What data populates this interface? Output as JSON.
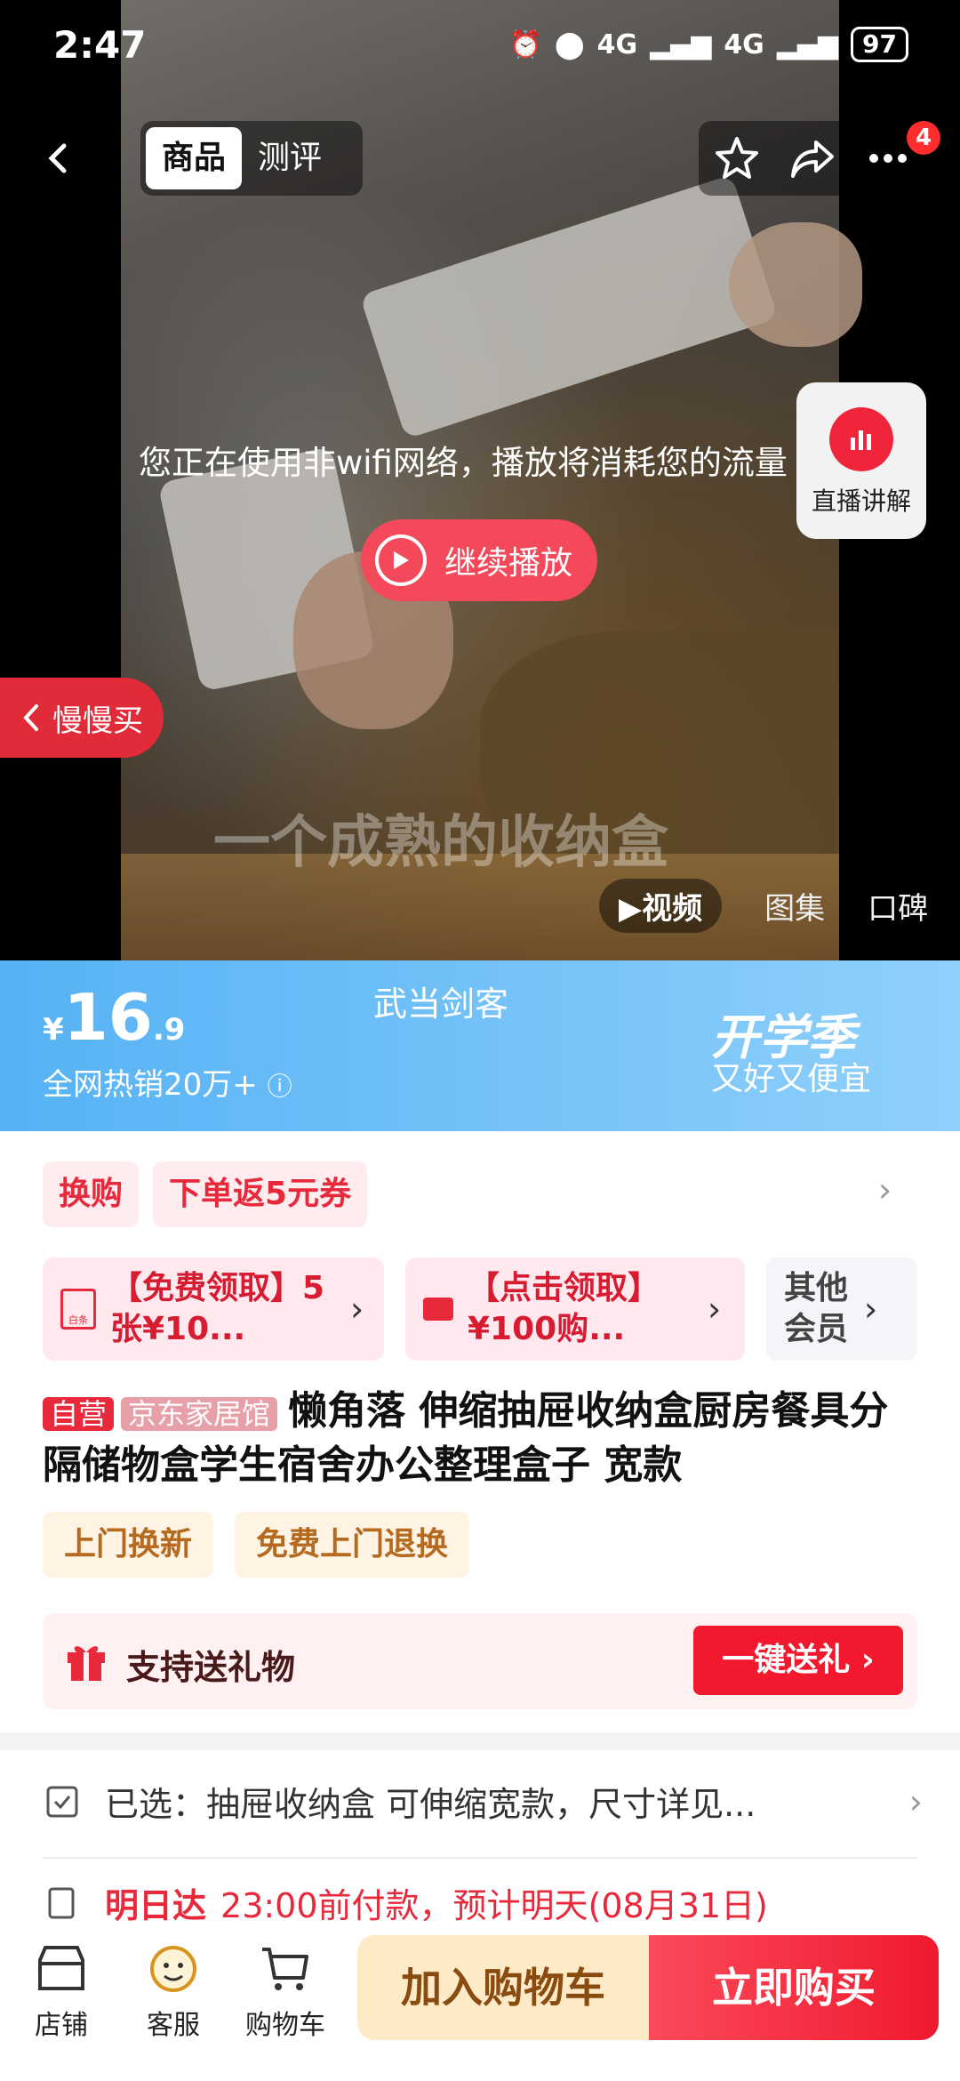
{
  "status_bar": {
    "time": "2:47",
    "network1": "4G",
    "network2": "4G",
    "battery": "97"
  },
  "header": {
    "tabs": [
      "商品",
      "测评"
    ],
    "badge_count": "4"
  },
  "video": {
    "wifi_notice": "您正在使用非wifi网络，播放将消耗您的流量",
    "continue_label": "继续播放",
    "slow_buy_label": "慢慢买",
    "live_label": "直播讲解",
    "caption": "一个成熟的收纳盒",
    "media_tabs": [
      "视频",
      "图集",
      "口碑"
    ]
  },
  "price_banner": {
    "currency": "¥",
    "price_int": "16",
    "price_dec": ".9",
    "sold_text": "全网热销20万+",
    "brand": "武当剑客",
    "season_title": "开学季",
    "season_sub": "又好又便宜"
  },
  "promos": {
    "chips": [
      "换购",
      "下单返5元券"
    ],
    "coupons": [
      "【免费领取】5张¥10...",
      "【点击领取】¥100购..."
    ],
    "coupon_small_icon_label": "白条",
    "member_label": "其他会员"
  },
  "product": {
    "tag_self": "自营",
    "tag_shop": "京东家居馆",
    "title": "懒角落  伸缩抽屉收纳盒厨房餐具分隔储物盒学生宿舍办公整理盒子 宽款",
    "services": [
      "上门换新",
      "免费上门退换"
    ],
    "gift_text": "支持送礼物",
    "gift_button": "一键送礼"
  },
  "selection": {
    "selected_text": "已选：抽屉收纳盒 可伸缩宽款，尺寸详见...",
    "delivery_tag": "明日达",
    "delivery_text": "23:00前付款，预计明天(08月31日)"
  },
  "bottom_bar": {
    "items": [
      "店铺",
      "客服",
      "购物车"
    ],
    "add_cart": "加入购物车",
    "buy_now": "立即购买"
  },
  "colors": {
    "accent_red": "#e8293b",
    "banner_blue": "#56b2f4",
    "cart_bg": "#fdeac7"
  }
}
